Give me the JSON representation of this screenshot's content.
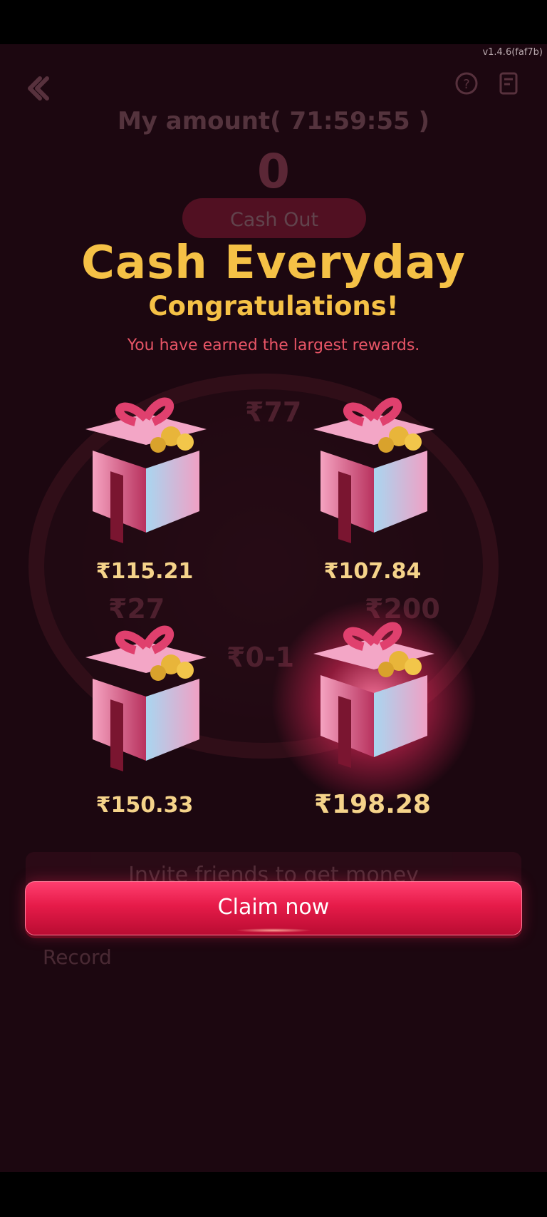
{
  "status": {
    "version": "v1.4.6(faf7b)"
  },
  "background_page": {
    "my_amount_label": "My amount( 71:59:55 )",
    "amount_value": "0",
    "cashout_label": "Cash Out",
    "wheel_labels": [
      "₹77",
      "₹27",
      "₹200",
      "₹0-1"
    ],
    "invite_label": "Invite friends to get money",
    "record_label": "Record",
    "icons": [
      "back-icon",
      "help-icon",
      "record-icon"
    ]
  },
  "modal": {
    "title": "Cash Everyday",
    "subtitle": "Congratulations!",
    "note": "You have earned the largest rewards.",
    "gifts": [
      {
        "amount": "₹115.21",
        "highlighted": false
      },
      {
        "amount": "₹107.84",
        "highlighted": false
      },
      {
        "amount": "₹150.33",
        "highlighted": false
      },
      {
        "amount": "₹198.28",
        "highlighted": true
      }
    ],
    "claim_label": "Claim now"
  },
  "colors": {
    "background": "#1c0710",
    "gold_text": "#f5c146",
    "note_red": "#e85566",
    "claim_button": "#e61b49",
    "amount_text": "#f5d38a"
  }
}
